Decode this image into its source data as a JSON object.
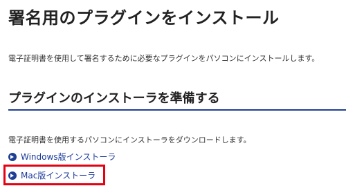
{
  "page": {
    "title": "署名用のプラグインをインストール",
    "intro": "電子証明書を使用して署名するために必要なプラグインをパソコンにインストールします。"
  },
  "section": {
    "title": "プラグインのインストーラを準備する",
    "description": "電子証明書を使用するパソコンにインストーラをダウンロードします。",
    "accent_color": "#1f3f94",
    "links": [
      {
        "label": "Windows版インストーラ",
        "icon": "arrow-circle-right-icon"
      },
      {
        "label": "Mac版インストーラ",
        "icon": "arrow-circle-right-icon",
        "highlighted": true
      }
    ]
  },
  "highlight_color": "#e60012"
}
